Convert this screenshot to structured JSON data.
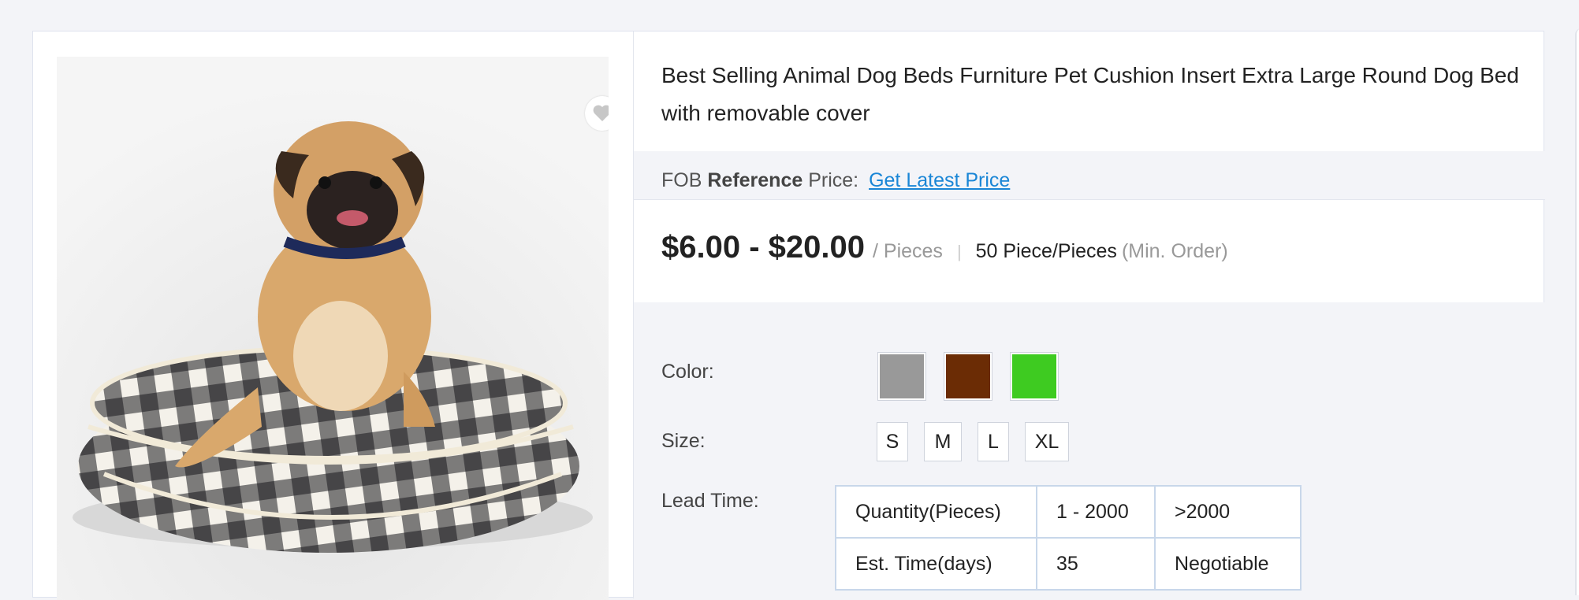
{
  "product": {
    "title": "Best Selling Animal Dog Beds Furniture Pet Cushion Insert Extra Large Round Dog Bed with removable cover",
    "image_icon": "pug-on-checkered-round-dog-bed",
    "favorite_icon": "heart-icon"
  },
  "fob": {
    "prefix": "FOB",
    "reference": "Reference",
    "price_word": "Price:",
    "link_label": "Get Latest Price"
  },
  "pricing": {
    "range": "$6.00 - $20.00",
    "unit": "/ Pieces",
    "separator": "|",
    "min_order": "50 Piece/Pieces",
    "min_order_note": "(Min. Order)"
  },
  "attributes": {
    "color_label": "Color:",
    "colors": [
      "#999999",
      "#6b2c05",
      "#3ecb21"
    ],
    "size_label": "Size:",
    "sizes": [
      "S",
      "M",
      "L",
      "XL"
    ],
    "lead_time_label": "Lead Time:",
    "lead_time_table": {
      "rows": [
        [
          "Quantity(Pieces)",
          "1 - 2000",
          ">2000"
        ],
        [
          "Est. Time(days)",
          "35",
          "Negotiable"
        ]
      ]
    }
  }
}
